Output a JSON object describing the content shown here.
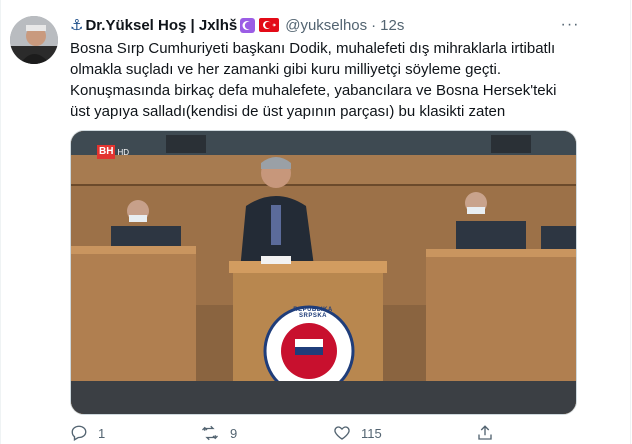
{
  "author": {
    "anchor_symbol": "⚓",
    "display_name": "Dr.Yüksel Hoş | Jxlhš",
    "handle": "@yukselhos",
    "separator": "·",
    "time": "12s"
  },
  "more_symbol": "···",
  "tweet": {
    "lines": [
      "Bosna Sırp Cumhuriyeti başkanı Dodik, muhalefeti dış mihraklarla irtibatlı olmakla suçladı ve her zamanki gibi kuru milliyetçi söyleme geçti.",
      "Konuşmasında birkaç defa muhalefete, yabancılara ve Bosna Hersek'teki üst yapıya salladı(kendisi de üst yapının parçası) bu klasikti zaten"
    ]
  },
  "media": {
    "channel_logo": "BH",
    "channel_sub": "HD",
    "seal_text": "REPUBLIKA SRPSKA"
  },
  "actions": {
    "reply_count": "1",
    "retweet_count": "9",
    "like_count": "115"
  },
  "colors": {
    "text": "#0f1419",
    "secondary": "#536471",
    "border": "#cfd9de"
  }
}
